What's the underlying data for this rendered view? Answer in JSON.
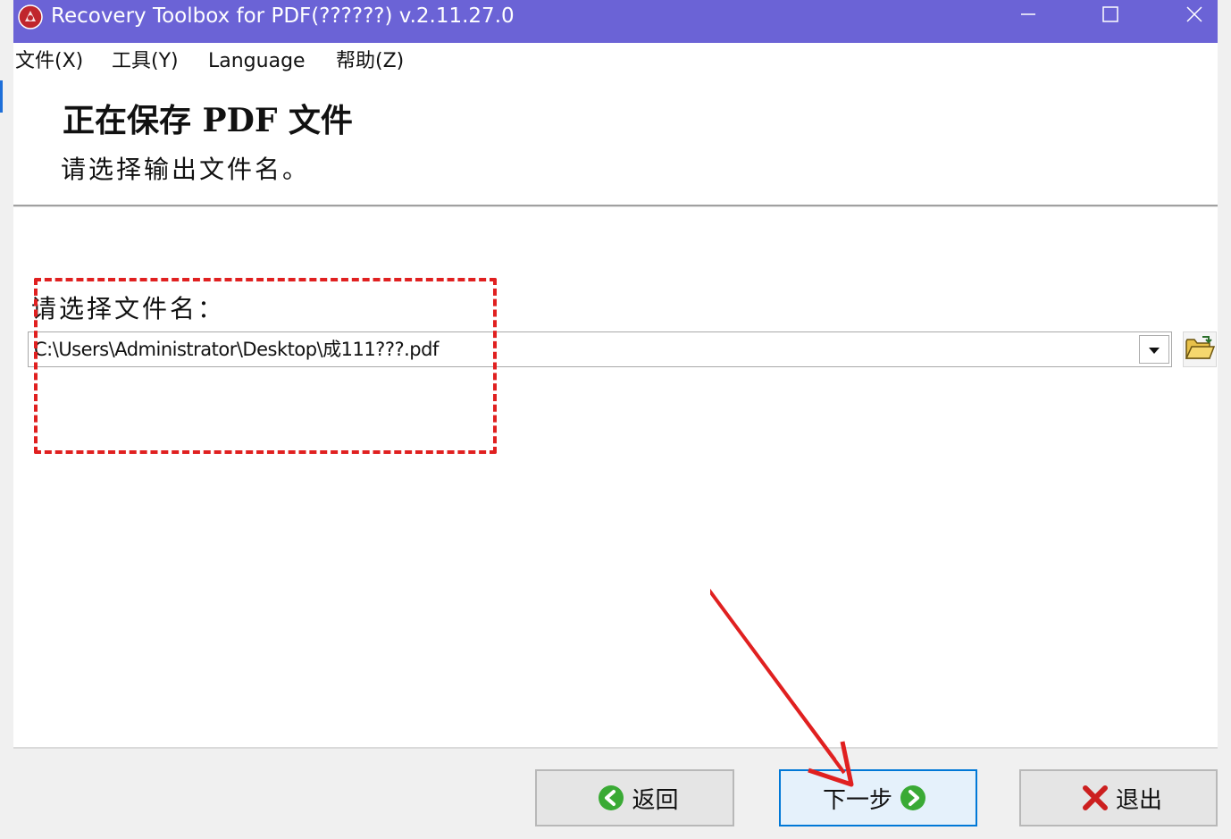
{
  "window": {
    "title": "Recovery Toolbox for PDF(??????) v.2.11.27.0"
  },
  "menu": {
    "items": [
      "文件(X)",
      "工具(Y)",
      "Language",
      "帮助(Z)"
    ]
  },
  "header": {
    "title": "正在保存 PDF 文件",
    "subtitle": "请选择输出文件名。"
  },
  "form": {
    "label": "请选择文件名：",
    "file_path": "C:\\Users\\Administrator\\Desktop\\成111???.pdf"
  },
  "buttons": {
    "back": "返回",
    "next": "下一步",
    "exit": "退出"
  },
  "colors": {
    "titlebar": "#6b63d6",
    "annotation": "#e02020",
    "nav_icon": "#3aaa35",
    "exit_icon": "#cc1f1f"
  }
}
